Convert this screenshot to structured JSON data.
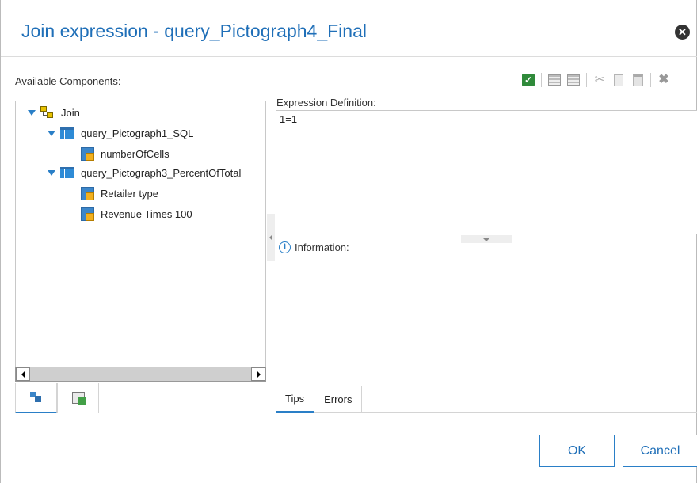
{
  "dialog": {
    "title": "Join expression - query_Pictograph4_Final",
    "close_icon": "close-icon"
  },
  "components": {
    "label": "Available Components:",
    "tree": {
      "root": "Join",
      "queries": [
        {
          "name": "query_Pictograph1_SQL",
          "items": [
            "numberOfCells"
          ]
        },
        {
          "name": "query_Pictograph3_PercentOfTotal",
          "items": [
            "Retailer type",
            "Revenue Times 100"
          ]
        }
      ]
    },
    "tabs": [
      "source-tree-icon",
      "data-items-icon"
    ]
  },
  "toolbar": {
    "icons": [
      "validate-check-icon",
      "lines-icon",
      "lines-alt-icon",
      "cut-icon",
      "copy-icon",
      "paste-icon",
      "delete-icon"
    ]
  },
  "expression": {
    "label": "Expression Definition:",
    "value": "1=1"
  },
  "information": {
    "label": "Information:",
    "tabs": [
      "Tips",
      "Errors"
    ]
  },
  "buttons": {
    "ok": "OK",
    "cancel": "Cancel"
  },
  "colors": {
    "accent": "#2a7fc7",
    "title": "#1f6fb8"
  }
}
